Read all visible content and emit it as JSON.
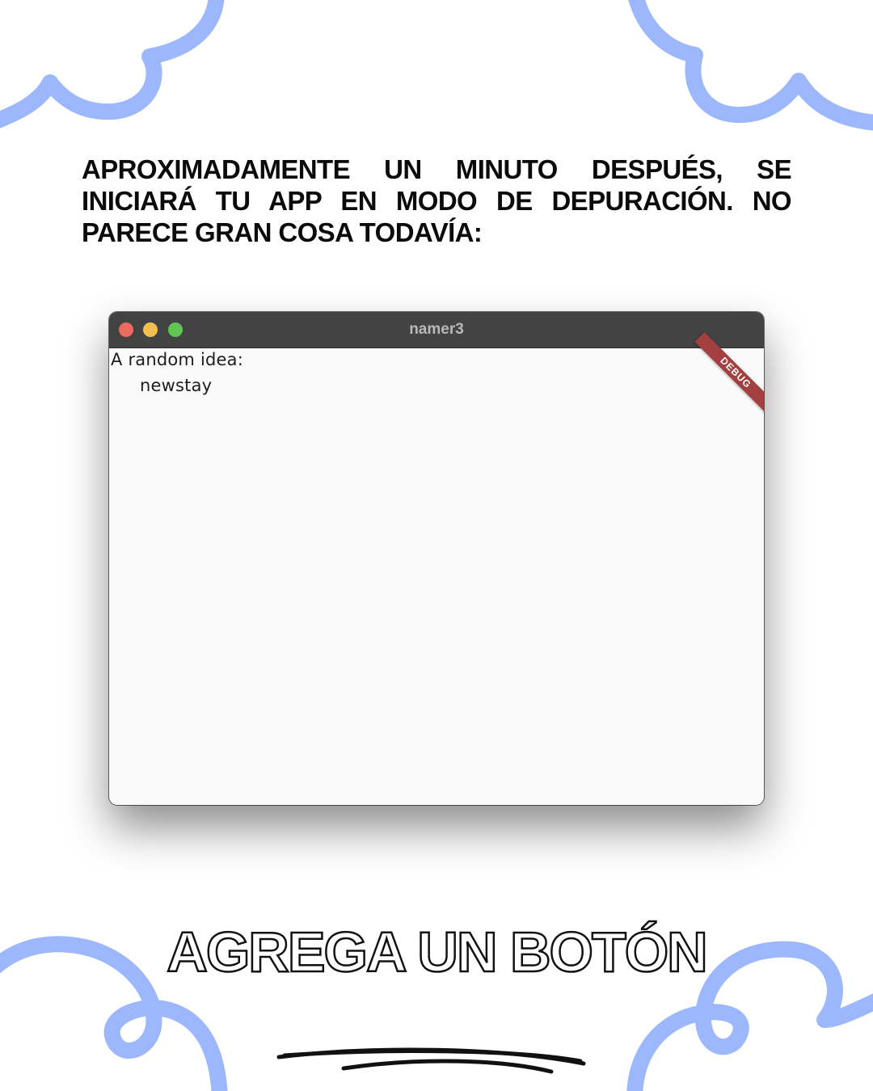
{
  "caption": "APROXIMADAMENTE UN MINUTO DESPUÉS, SE INICIARÁ TU APP EN MODO DE DEPURACIÓN. NO PARECE GRAN COSA TODAVÍA:",
  "window": {
    "title": "namer3",
    "content": {
      "label": "A random idea:",
      "word": "newstay"
    },
    "debug_banner": "DEBUG"
  },
  "heading": "AGREGA UN BOTÓN",
  "colors": {
    "decor_blue": "#9db7fc",
    "titlebar": "#434343",
    "debug_banner": "#a33f3f",
    "traffic_close": "#ed6a5e",
    "traffic_minimize": "#f4bf4f",
    "traffic_maximize": "#61c554"
  }
}
